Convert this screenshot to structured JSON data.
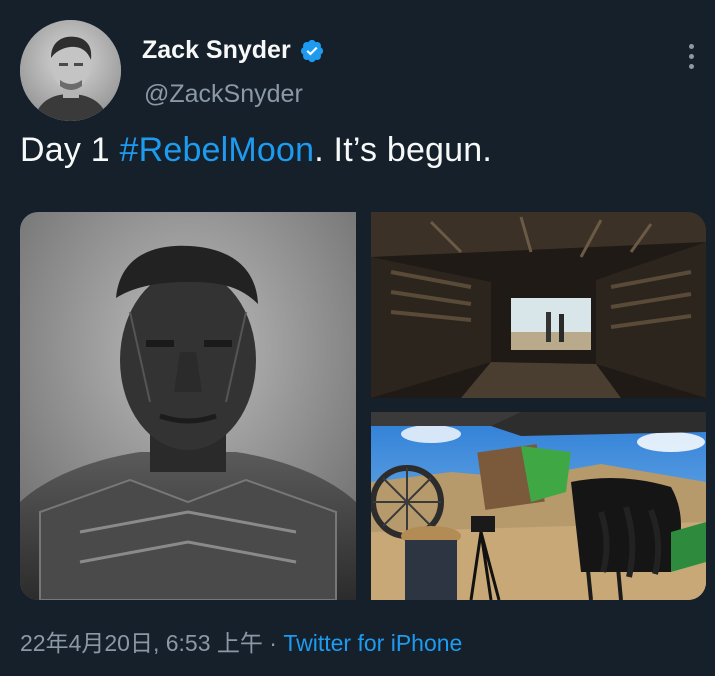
{
  "author": {
    "display_name": "Zack Snyder",
    "handle": "@ZackSnyder",
    "verified": true,
    "avatar_icon": "profile-photo"
  },
  "tweet": {
    "text_before": "Day 1 ",
    "hashtag": "#RebelMoon",
    "text_after": ". It’s begun."
  },
  "media": [
    {
      "icon": "portrait-photo"
    },
    {
      "icon": "spaceship-interior-photo"
    },
    {
      "icon": "film-set-photo"
    }
  ],
  "meta": {
    "timestamp": "22年4月20日, 6:53 上午",
    "separator": " · ",
    "source": "Twitter for iPhone"
  },
  "colors": {
    "background": "#15202b",
    "link": "#1d9bf0",
    "secondary_text": "#8b98a5",
    "verified": "#1d9bf0"
  }
}
